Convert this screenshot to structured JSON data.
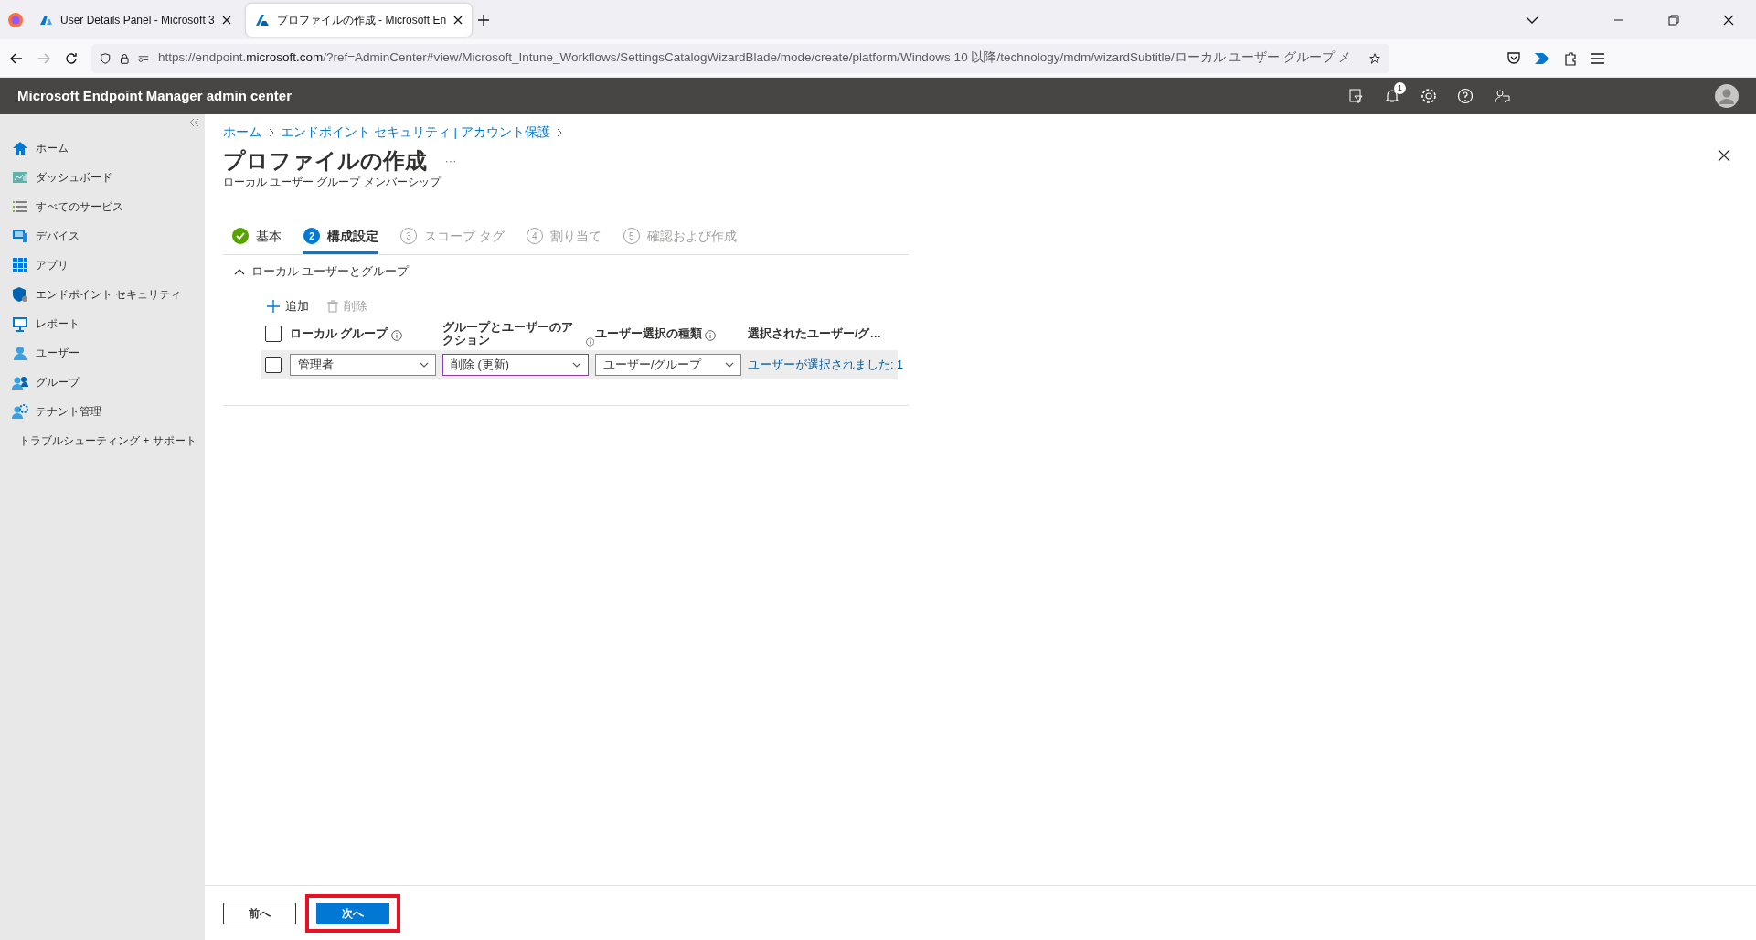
{
  "browser": {
    "tabs": [
      {
        "title": "User Details Panel - Microsoft 3",
        "selected": false
      },
      {
        "title": "プロファイルの作成 - Microsoft En",
        "selected": true
      }
    ],
    "url_host": "https://endpoint.",
    "url_domain": "microsoft.com",
    "url_rest": "/?ref=AdminCenter#view/Microsoft_Intune_Workflows/SettingsCatalogWizardBlade/mode/create/platform/Windows 10 以降/technology/mdm/wizardSubtitle/ローカル ユーザー グループ メ"
  },
  "app": {
    "title": "Microsoft Endpoint Manager admin center",
    "notification_count": "1"
  },
  "sidebar": {
    "items": [
      {
        "label": "ホーム"
      },
      {
        "label": "ダッシュボード"
      },
      {
        "label": "すべてのサービス"
      },
      {
        "label": "デバイス"
      },
      {
        "label": "アプリ"
      },
      {
        "label": "エンドポイント セキュリティ"
      },
      {
        "label": "レポート"
      },
      {
        "label": "ユーザー"
      },
      {
        "label": "グループ"
      },
      {
        "label": "テナント管理"
      },
      {
        "label": "トラブルシューティング + サポート"
      }
    ]
  },
  "breadcrumb": [
    "ホーム",
    "エンドポイント セキュリティ | アカウント保護"
  ],
  "page": {
    "title": "プロファイルの作成",
    "more": "···",
    "subtitle": "ローカル ユーザー グループ メンバーシップ"
  },
  "steps": [
    {
      "label": "基本",
      "completed": true,
      "selected": false
    },
    {
      "number": "2",
      "label": "構成設定",
      "completed": false,
      "selected": true
    },
    {
      "number": "3",
      "label": "スコープ タグ",
      "completed": false,
      "selected": false
    },
    {
      "number": "4",
      "label": "割り当て",
      "completed": false,
      "selected": false
    },
    {
      "number": "5",
      "label": "確認および作成",
      "completed": false,
      "selected": false
    }
  ],
  "section": {
    "title": "ローカル ユーザーとグループ",
    "expanded": true
  },
  "toolbar": [
    {
      "label": "追加",
      "disabled": false
    },
    {
      "label": "削除",
      "disabled": true
    }
  ],
  "table": {
    "columns": [
      {
        "label": "ローカル グループ"
      },
      {
        "label": "グループとユーザーのアクション"
      },
      {
        "label": "ユーザー選択の種類"
      },
      {
        "label": "選択されたユーザー/グ…"
      }
    ],
    "header_checked": false,
    "rows": [
      {
        "checked": false,
        "local_group": "管理者",
        "action": "削除 (更新)",
        "action_focused": true,
        "selection_type": "ユーザー/グループ",
        "selected_link": "ユーザーが選択されました: 1"
      }
    ]
  },
  "footer": {
    "buttons": [
      {
        "label": "前へ",
        "kind": "secondary",
        "highlighted": false
      },
      {
        "label": "次へ",
        "kind": "primary",
        "highlighted": true
      }
    ]
  }
}
